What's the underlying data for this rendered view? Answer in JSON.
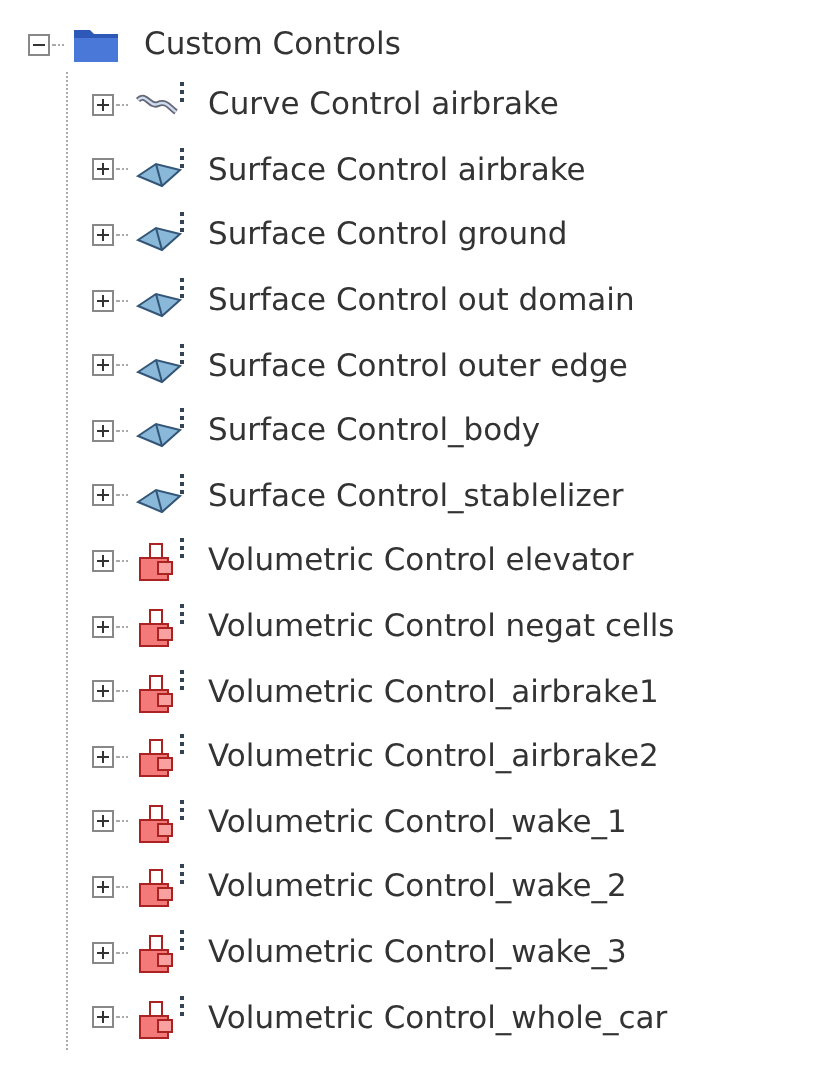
{
  "tree": {
    "label": "Custom Controls",
    "kind": "folder",
    "expanded": true,
    "children": [
      {
        "label": "Curve Control airbrake",
        "kind": "curve",
        "expanded": false
      },
      {
        "label": "Surface Control airbrake",
        "kind": "surface",
        "expanded": false
      },
      {
        "label": "Surface Control ground",
        "kind": "surface",
        "expanded": false
      },
      {
        "label": "Surface Control out domain",
        "kind": "surface",
        "expanded": false
      },
      {
        "label": "Surface Control outer edge",
        "kind": "surface",
        "expanded": false
      },
      {
        "label": "Surface Control_body",
        "kind": "surface",
        "expanded": false
      },
      {
        "label": "Surface Control_stablelizer",
        "kind": "surface",
        "expanded": false
      },
      {
        "label": "Volumetric Control elevator",
        "kind": "volume",
        "expanded": false
      },
      {
        "label": "Volumetric Control negat cells",
        "kind": "volume",
        "expanded": false
      },
      {
        "label": "Volumetric Control_airbrake1",
        "kind": "volume",
        "expanded": false
      },
      {
        "label": "Volumetric Control_airbrake2",
        "kind": "volume",
        "expanded": false
      },
      {
        "label": "Volumetric Control_wake_1",
        "kind": "volume",
        "expanded": false
      },
      {
        "label": "Volumetric Control_wake_2",
        "kind": "volume",
        "expanded": false
      },
      {
        "label": "Volumetric Control_wake_3",
        "kind": "volume",
        "expanded": false
      },
      {
        "label": "Volumetric Control_whole_car",
        "kind": "volume",
        "expanded": false
      }
    ]
  }
}
